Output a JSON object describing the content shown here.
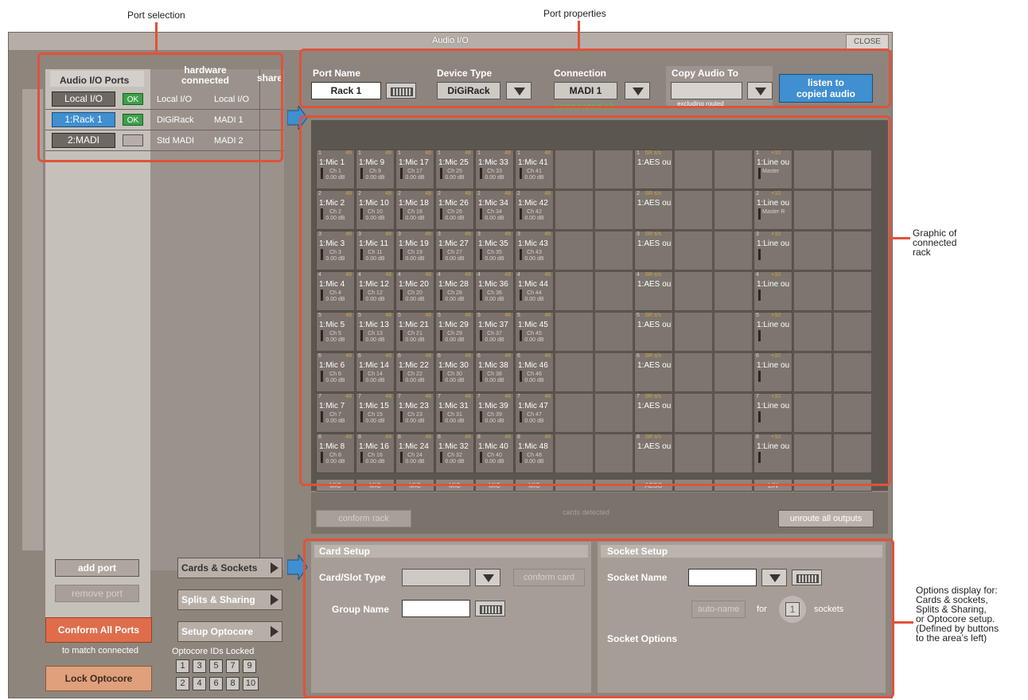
{
  "annotations": {
    "port_selection": "Port selection",
    "port_properties": "Port properties",
    "rack_graphic": [
      "Graphic of",
      "connected",
      "rack"
    ],
    "options": [
      "Options display for:",
      "Cards & sockets,",
      "Splits & Sharing,",
      "or Optocore setup.",
      "(Defined by buttons",
      "to the area’s  left)"
    ]
  },
  "window": {
    "title": "Audio I/O",
    "close": "CLOSE"
  },
  "ports": {
    "header_ports": "Audio I/O Ports",
    "header_hw": "hardware\nconnected",
    "header_hw_line1": "hardware",
    "header_hw_line2": "connected",
    "header_share": "share",
    "rows": [
      {
        "name": "Local I/O",
        "status": "OK",
        "hw1": "Local I/O",
        "hw2": "Local I/O",
        "selected": false
      },
      {
        "name": "1:Rack 1",
        "status": "OK",
        "hw1": "DiGiRack",
        "hw2": "MADI 1",
        "selected": true
      },
      {
        "name": "2:MADI",
        "status": "",
        "hw1": "Std MADI",
        "hw2": "MADI 2",
        "selected": false
      }
    ]
  },
  "left_buttons": {
    "add_port": "add port",
    "remove_port": "remove port",
    "conform_all": "Conform All Ports",
    "to_match": "to match connected",
    "lock_optocore": "Lock Optocore",
    "cards_sockets": "Cards & Sockets",
    "splits_sharing": "Splits & Sharing",
    "setup_optocore": "Setup Optocore",
    "optocore_ids_label": "Optocore IDs Locked",
    "optocore_ids_top": [
      "1",
      "3",
      "5",
      "7",
      "9"
    ],
    "optocore_ids_bottom": [
      "2",
      "4",
      "6",
      "8",
      "10"
    ]
  },
  "port_props": {
    "port_name_label": "Port Name",
    "port_name_value": "Rack 1",
    "device_type_label": "Device Type",
    "device_type_value": "DiGiRack",
    "connection_label": "Connection",
    "connection_value": "MADI 1",
    "connection_status": "connected ok",
    "copy_audio_label": "Copy Audio To",
    "copy_audio_value": "",
    "excluding": "excluding routed",
    "listen_line1": "listen to",
    "listen_line2": "copied audio"
  },
  "rack": {
    "mic_columns": [
      {
        "label": "MIC",
        "cells": [
          {
            "num": "1",
            "phan": "48",
            "name": "1:Mic 1",
            "sub": "Ch 1",
            "gain": "0.00"
          },
          {
            "num": "2",
            "phan": "48",
            "name": "1:Mic 2",
            "sub": "Ch 2",
            "gain": "0.00"
          },
          {
            "num": "3",
            "phan": "48",
            "name": "1:Mic 3",
            "sub": "Ch 3",
            "gain": "0.00"
          },
          {
            "num": "4",
            "phan": "48",
            "name": "1:Mic 4",
            "sub": "Ch 4",
            "gain": "0.00"
          },
          {
            "num": "5",
            "phan": "48",
            "name": "1:Mic 5",
            "sub": "Ch 5",
            "gain": "0.00"
          },
          {
            "num": "6",
            "phan": "48",
            "name": "1:Mic 6",
            "sub": "Ch 6",
            "gain": "0.00"
          },
          {
            "num": "7",
            "phan": "48",
            "name": "1:Mic 7",
            "sub": "Ch 7",
            "gain": "0.00"
          },
          {
            "num": "8",
            "phan": "48",
            "name": "1:Mic 8",
            "sub": "Ch 8",
            "gain": "0.00"
          }
        ]
      },
      {
        "label": "MIC",
        "cells": [
          {
            "num": "1",
            "phan": "48",
            "name": "1:Mic 9",
            "sub": "Ch 9",
            "gain": "0.00"
          },
          {
            "num": "2",
            "phan": "48",
            "name": "1:Mic 10",
            "sub": "Ch 10",
            "gain": "0.00"
          },
          {
            "num": "3",
            "phan": "48",
            "name": "1:Mic 11",
            "sub": "Ch 11",
            "gain": "0.00"
          },
          {
            "num": "4",
            "phan": "48",
            "name": "1:Mic 12",
            "sub": "Ch 12",
            "gain": "0.00"
          },
          {
            "num": "5",
            "phan": "48",
            "name": "1:Mic 13",
            "sub": "Ch 13",
            "gain": "0.00"
          },
          {
            "num": "6",
            "phan": "48",
            "name": "1:Mic 14",
            "sub": "Ch 14",
            "gain": "0.00"
          },
          {
            "num": "7",
            "phan": "48",
            "name": "1:Mic 15",
            "sub": "Ch 15",
            "gain": "0.00"
          },
          {
            "num": "8",
            "phan": "48",
            "name": "1:Mic 16",
            "sub": "Ch 16",
            "gain": "0.00"
          }
        ]
      },
      {
        "label": "MIC",
        "cells": [
          {
            "num": "1",
            "phan": "48",
            "name": "1:Mic 17",
            "sub": "Ch 17",
            "gain": "0.00"
          },
          {
            "num": "2",
            "phan": "48",
            "name": "1:Mic 18",
            "sub": "Ch 18",
            "gain": "0.00"
          },
          {
            "num": "3",
            "phan": "48",
            "name": "1:Mic 19",
            "sub": "Ch 19",
            "gain": "0.00"
          },
          {
            "num": "4",
            "phan": "48",
            "name": "1:Mic 20",
            "sub": "Ch 20",
            "gain": "0.00"
          },
          {
            "num": "5",
            "phan": "48",
            "name": "1:Mic 21",
            "sub": "Ch 21",
            "gain": "0.00"
          },
          {
            "num": "6",
            "phan": "48",
            "name": "1:Mic 22",
            "sub": "Ch 22",
            "gain": "0.00"
          },
          {
            "num": "7",
            "phan": "48",
            "name": "1:Mic 23",
            "sub": "Ch 23",
            "gain": "0.00"
          },
          {
            "num": "8",
            "phan": "48",
            "name": "1:Mic 24",
            "sub": "Ch 24",
            "gain": "0.00"
          }
        ]
      },
      {
        "label": "MIC",
        "cells": [
          {
            "num": "1",
            "phan": "48",
            "name": "1:Mic 25",
            "sub": "Ch 25",
            "gain": "0.00"
          },
          {
            "num": "2",
            "phan": "48",
            "name": "1:Mic 26",
            "sub": "Ch 26",
            "gain": "0.00"
          },
          {
            "num": "3",
            "phan": "48",
            "name": "1:Mic 27",
            "sub": "Ch 27",
            "gain": "0.00"
          },
          {
            "num": "4",
            "phan": "48",
            "name": "1:Mic 28",
            "sub": "Ch 28",
            "gain": "0.00"
          },
          {
            "num": "5",
            "phan": "48",
            "name": "1:Mic 29",
            "sub": "Ch 29",
            "gain": "0.00"
          },
          {
            "num": "6",
            "phan": "48",
            "name": "1:Mic 30",
            "sub": "Ch 30",
            "gain": "0.00"
          },
          {
            "num": "7",
            "phan": "48",
            "name": "1:Mic 31",
            "sub": "Ch 31",
            "gain": "0.00"
          },
          {
            "num": "8",
            "phan": "48",
            "name": "1:Mic 32",
            "sub": "Ch 32",
            "gain": "0.00"
          }
        ]
      },
      {
        "label": "MIC",
        "cells": [
          {
            "num": "1",
            "phan": "48",
            "name": "1:Mic 33",
            "sub": "Ch 33",
            "gain": "0.00"
          },
          {
            "num": "2",
            "phan": "48",
            "name": "1:Mic 34",
            "sub": "Ch 34",
            "gain": "0.00"
          },
          {
            "num": "3",
            "phan": "48",
            "name": "1:Mic 35",
            "sub": "Ch 35",
            "gain": "0.00"
          },
          {
            "num": "4",
            "phan": "48",
            "name": "1:Mic 36",
            "sub": "Ch 36",
            "gain": "0.00"
          },
          {
            "num": "5",
            "phan": "48",
            "name": "1:Mic 37",
            "sub": "Ch 37",
            "gain": "0.00"
          },
          {
            "num": "6",
            "phan": "48",
            "name": "1:Mic 38",
            "sub": "Ch 38",
            "gain": "0.00"
          },
          {
            "num": "7",
            "phan": "48",
            "name": "1:Mic 39",
            "sub": "Ch 39",
            "gain": "0.00"
          },
          {
            "num": "8",
            "phan": "48",
            "name": "1:Mic 40",
            "sub": "Ch 40",
            "gain": "0.00"
          }
        ]
      },
      {
        "label": "MIC",
        "cells": [
          {
            "num": "1",
            "phan": "48",
            "name": "1:Mic 41",
            "sub": "Ch 41",
            "gain": "0.00"
          },
          {
            "num": "2",
            "phan": "48",
            "name": "1:Mic 42",
            "sub": "Ch 42",
            "gain": "0.00"
          },
          {
            "num": "3",
            "phan": "48",
            "name": "1:Mic 43",
            "sub": "Ch 43",
            "gain": "0.00"
          },
          {
            "num": "4",
            "phan": "48",
            "name": "1:Mic 44",
            "sub": "Ch 44",
            "gain": "0.00"
          },
          {
            "num": "5",
            "phan": "48",
            "name": "1:Mic 45",
            "sub": "Ch 45",
            "gain": "0.00"
          },
          {
            "num": "6",
            "phan": "48",
            "name": "1:Mic 46",
            "sub": "Ch 46",
            "gain": "0.00"
          },
          {
            "num": "7",
            "phan": "48",
            "name": "1:Mic 47",
            "sub": "Ch 47",
            "gain": "0.00"
          },
          {
            "num": "8",
            "phan": "48",
            "name": "1:Mic 48",
            "sub": "Ch 48",
            "gain": "0.00"
          }
        ]
      }
    ],
    "gain_unit": "dB",
    "aes_column": {
      "label": "AESO",
      "tag": "SR s/s",
      "cells": [
        {
          "num": "1",
          "name": "1:AES ou"
        },
        {
          "num": "2",
          "name": "1:AES ou"
        },
        {
          "num": "3",
          "name": "1:AES ou"
        },
        {
          "num": "4",
          "name": "1:AES ou"
        },
        {
          "num": "5",
          "name": "1:AES ou"
        },
        {
          "num": "6",
          "name": "1:AES ou"
        },
        {
          "num": "7",
          "name": "1:AES ou"
        },
        {
          "num": "8",
          "name": "1:AES ou"
        }
      ]
    },
    "lin_column": {
      "label": "LIN",
      "tag": "+10",
      "cells": [
        {
          "num": "1",
          "name": "1:Line ou",
          "sub": "Master"
        },
        {
          "num": "2",
          "name": "1:Line ou",
          "sub": "Master R"
        },
        {
          "num": "3",
          "name": "1:Line ou",
          "sub": ""
        },
        {
          "num": "4",
          "name": "1:Line ou",
          "sub": ""
        },
        {
          "num": "5",
          "name": "1:Line ou",
          "sub": ""
        },
        {
          "num": "6",
          "name": "1:Line ou",
          "sub": ""
        },
        {
          "num": "7",
          "name": "1:Line ou",
          "sub": ""
        },
        {
          "num": "8",
          "name": "1:Line ou",
          "sub": ""
        }
      ]
    },
    "conform_rack": "conform rack",
    "cards_detected": "cards detected",
    "unroute_all": "unroute all outputs"
  },
  "card_setup": {
    "title": "Card Setup",
    "card_slot_type": "Card/Slot Type",
    "conform_card": "conform card",
    "group_name": "Group Name"
  },
  "socket_setup": {
    "title": "Socket Setup",
    "socket_name": "Socket Name",
    "auto_name": "auto-name",
    "for": "for",
    "count": "1",
    "sockets": "sockets",
    "socket_options": "Socket Options"
  },
  "colors": {
    "accent_red": "#e0523a",
    "ok_green": "#3ea04a",
    "selected_blue": "#3f8fd1",
    "orange_button": "#df6d4c"
  }
}
